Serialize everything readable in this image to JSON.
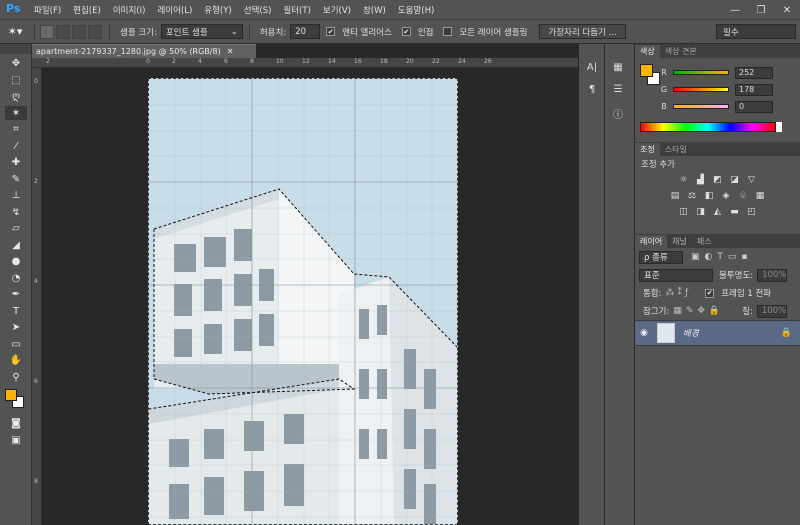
{
  "app": {
    "logo": "Ps"
  },
  "menu": [
    "파일(F)",
    "편집(E)",
    "이미지(I)",
    "레이어(L)",
    "유형(Y)",
    "선택(S)",
    "필터(T)",
    "보기(V)",
    "창(W)",
    "도움말(H)"
  ],
  "options": {
    "sample_size_label": "샘플 크기:",
    "sample_size_value": "포인트 샘플",
    "tolerance_label": "허용치:",
    "tolerance_value": "20",
    "antialias_label": "앤티 앨리어스",
    "contiguous_label": "인접",
    "all_layers_label": "모든 레이어 샘플링",
    "refine_button": "가장자리 다듬기 ...",
    "workspace": "필수"
  },
  "document": {
    "tab_title": "apartment-2179337_1280.jpg @ 50% (RGB/8)"
  },
  "ruler_h": [
    "2",
    "0",
    "2",
    "4",
    "6",
    "8",
    "10",
    "12",
    "14",
    "16",
    "18",
    "20",
    "22",
    "24",
    "26"
  ],
  "ruler_v": [
    "0",
    "2",
    "4",
    "6",
    "8"
  ],
  "color_panel": {
    "tabs": [
      "색상",
      "색상 견본"
    ],
    "r_label": "R",
    "g_label": "G",
    "b_label": "B",
    "r_value": "252",
    "g_value": "178",
    "b_value": "0",
    "fg_color": "#fcb200",
    "bg_color": "#ffffff"
  },
  "adjust_panel": {
    "tabs": [
      "조정",
      "스타일"
    ],
    "title": "조정 추가"
  },
  "layers_panel": {
    "tabs": [
      "레이어",
      "채널",
      "패스"
    ],
    "filter_label": "ρ 종류",
    "blend_mode": "표준",
    "opacity_label": "불투명도:",
    "opacity_value": "100%",
    "unify_label": "통합:",
    "frame_label": "프레임 1 전파",
    "lock_label": "잠그기:",
    "fill_label": "칠:",
    "fill_value": "100%",
    "layer_name": "배경"
  }
}
